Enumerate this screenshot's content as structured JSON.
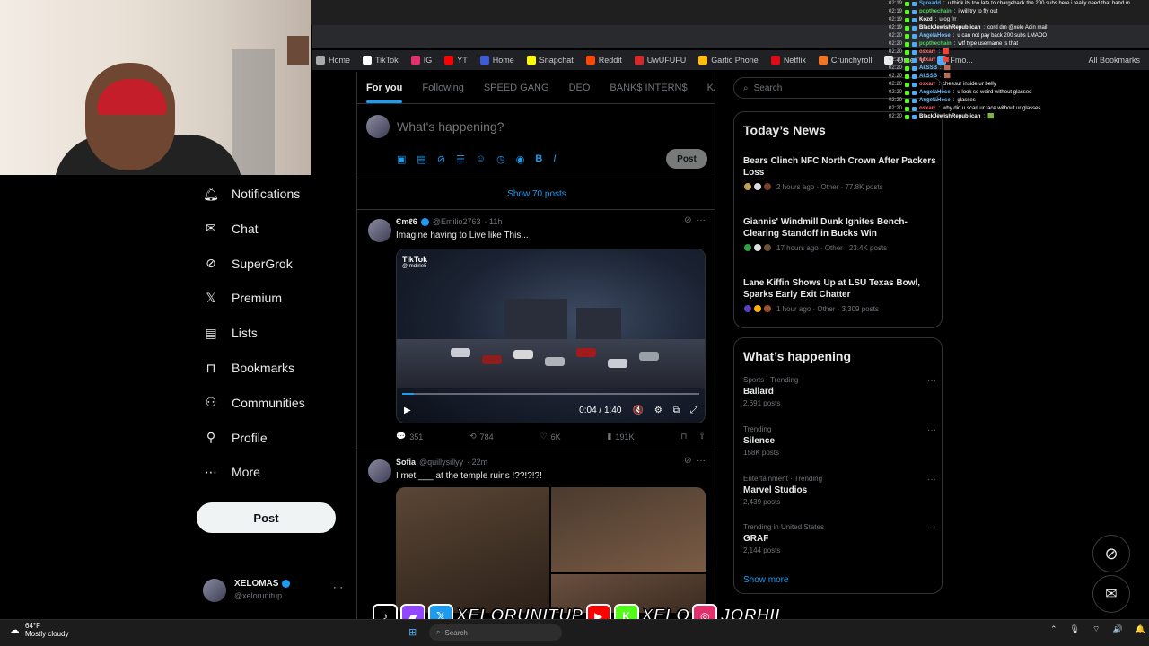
{
  "bookmarks": [
    "Home",
    "TikTok",
    "IG",
    "YT",
    "Home",
    "Snapchat",
    "Reddit",
    "UwUFUFU",
    "Gartic Phone",
    "Netflix",
    "Crunchyroll",
    "OmeTV",
    "Fmo..."
  ],
  "bookmark_colors": [
    "#aaa",
    "#fff",
    "#e1306c",
    "#ff0000",
    "#3b5bdb",
    "#fffc00",
    "#ff4500",
    "#d62828",
    "#ffbe0b",
    "#e50914",
    "#f47521",
    "#e9ecef",
    "#4dabf7"
  ],
  "all_bookmarks": "All Bookmarks",
  "sidebar": {
    "items": [
      {
        "label": "Notifications",
        "icon": "bell-icon"
      },
      {
        "label": "Chat",
        "icon": "mail-icon"
      },
      {
        "label": "SuperGrok",
        "icon": "grok-icon"
      },
      {
        "label": "Premium",
        "icon": "x-logo-icon"
      },
      {
        "label": "Lists",
        "icon": "list-icon"
      },
      {
        "label": "Bookmarks",
        "icon": "bookmark-icon"
      },
      {
        "label": "Communities",
        "icon": "communities-icon"
      },
      {
        "label": "Profile",
        "icon": "profile-icon"
      },
      {
        "label": "More",
        "icon": "more-icon"
      }
    ],
    "post_label": "Post",
    "profile": {
      "name": "XELOMAS",
      "handle": "@xelorunitup"
    }
  },
  "main": {
    "tabs": [
      "For you",
      "Following",
      "SPEED GANG",
      "DEO",
      "BANK$ INTERN$",
      "KAI MA"
    ],
    "compose_placeholder": "What's happening?",
    "compose_post": "Post",
    "show_posts": "Show 70 posts",
    "posts": [
      {
        "name": "Єmℓ6",
        "handle": "@Emilio2763",
        "time": "· 11h",
        "text": "Imagine having to Live like This...",
        "tiktok": "TikTok",
        "tiktok_user": "@ mdirie5",
        "video_time": "0:04 / 1:40",
        "video_progress": 0.04,
        "replies": "351",
        "reposts": "784",
        "likes": "6K",
        "views": "191K"
      },
      {
        "name": "Sofia",
        "handle": "@quillysillyy",
        "time": "· 22m",
        "text": "I met ___ at the temple ruins !??!?!?!"
      }
    ]
  },
  "right": {
    "search_placeholder": "Search",
    "news_title": "Today’s News",
    "news": [
      {
        "title": "Bears Clinch NFC North Crown After Packers Loss",
        "meta": "2 hours ago · Other · 77.8K posts"
      },
      {
        "title": "Giannis' Windmill Dunk Ignites Bench-Clearing Standoff in Bucks Win",
        "meta": "17 hours ago · Other · 23.4K posts"
      },
      {
        "title": "Lane Kiffin Shows Up at LSU Texas Bowl, Sparks Early Exit Chatter",
        "meta": "1 hour ago · Other · 3,309 posts"
      }
    ],
    "happening_title": "What’s happening",
    "trends": [
      {
        "category": "Sports · Trending",
        "name": "Ballard",
        "posts": "2,691 posts"
      },
      {
        "category": "Trending",
        "name": "Silence",
        "posts": "158K posts"
      },
      {
        "category": "Entertainment · Trending",
        "name": "Marvel Studios",
        "posts": "2,439 posts"
      },
      {
        "category": "Trending in United States",
        "name": "GRAF",
        "posts": "2,144 posts"
      }
    ],
    "show_more": "Show more"
  },
  "chat": [
    {
      "time": "02:19",
      "user": "Spreadd",
      "color": "#4dabf7",
      "msg": "u think its too late to chargeback the 200 subs here i really need that band m"
    },
    {
      "time": "02:19",
      "user": "popthechain",
      "color": "#51cf66",
      "msg": "i will try to fly out"
    },
    {
      "time": "02:19",
      "user": "Kozd",
      "color": "#ffffff",
      "msg": "u og frr"
    },
    {
      "time": "02:19",
      "user": "BlackJewishRepublican",
      "color": "#ffffff",
      "msg": "cord dm @xelo Adin mail"
    },
    {
      "time": "02:20",
      "user": "AngelaHose",
      "color": "#74c0fc",
      "msg": "u can not pay back 200 subs LMAOO"
    },
    {
      "time": "02:20",
      "user": "popthechain",
      "color": "#51cf66",
      "msg": "wtf type username is that"
    },
    {
      "time": "02:20",
      "user": "osxarr",
      "color": "#ff6b6b",
      "msg": "🟥"
    },
    {
      "time": "02:20",
      "user": "osxarr",
      "color": "#ff6b6b",
      "msg": "🟥"
    },
    {
      "time": "02:20",
      "user": "AkSSB",
      "color": "#74c0fc",
      "msg": "🟫"
    },
    {
      "time": "02:20",
      "user": "AkSSB",
      "color": "#74c0fc",
      "msg": "🟫"
    },
    {
      "time": "02:20",
      "user": "osxarr",
      "color": "#ff6b6b",
      "msg": "cheesur inside ur belly"
    },
    {
      "time": "02:20",
      "user": "AngelaHose",
      "color": "#74c0fc",
      "msg": "u look so weird without glassed"
    },
    {
      "time": "02:20",
      "user": "AngelaHose",
      "color": "#74c0fc",
      "msg": "glasses"
    },
    {
      "time": "02:20",
      "user": "osxarr",
      "color": "#ff6b6b",
      "msg": "why did u scan ur face without ur glasses"
    },
    {
      "time": "02:20",
      "user": "BlackJewishRepublican",
      "color": "#ffffff",
      "msg": "🟩"
    }
  ],
  "banner": {
    "platforms": [
      "TikTok",
      "Twitch",
      "Twitter",
      "YouTube",
      "Kick",
      "Instagram"
    ],
    "platform_colors": [
      "#000000",
      "#9146ff",
      "#1d9bf0",
      "#ff0000",
      "#53fc18",
      "#e1306c"
    ],
    "handle_1": "XELORUNITUP",
    "handle_2": "XELO",
    "handle_3": "JORHII"
  },
  "taskbar": {
    "temp": "64°F",
    "weather": "Mostly cloudy",
    "search": "Search"
  }
}
